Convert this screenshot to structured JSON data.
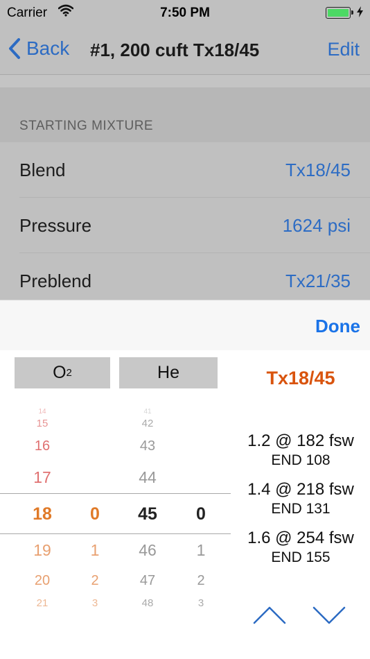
{
  "status": {
    "carrier": "Carrier",
    "time": "7:50 PM",
    "battery_color": "#4cd964"
  },
  "nav": {
    "back_label": "Back",
    "title": "#1, 200 cuft Tx18/45",
    "edit_label": "Edit"
  },
  "section": {
    "header": "STARTING MIXTURE"
  },
  "rows": [
    {
      "label": "Blend",
      "value": "Tx18/45"
    },
    {
      "label": "Pressure",
      "value": "1624 psi"
    },
    {
      "label": "Preblend",
      "value": "Tx21/35"
    }
  ],
  "picker": {
    "done_label": "Done",
    "o2_label": "O",
    "o2_sub": "2",
    "he_label": "He",
    "mix_name": "Tx18/45",
    "o2_tens": [
      "14",
      "15",
      "16",
      "17",
      "18",
      "19",
      "20",
      "21"
    ],
    "o2_units": [
      "0",
      "1",
      "2",
      "3"
    ],
    "he_tens": [
      "41",
      "42",
      "43",
      "44",
      "45",
      "46",
      "47",
      "48"
    ],
    "he_units": [
      "0",
      "1",
      "2",
      "3"
    ]
  },
  "mod": [
    {
      "line1": "1.2 @ 182 fsw",
      "line2": "END 108"
    },
    {
      "line1": "1.4 @ 218 fsw",
      "line2": "END 131"
    },
    {
      "line1": "1.6 @ 254 fsw",
      "line2": "END 155"
    }
  ],
  "colors": {
    "accent_blue": "#2c6bc3",
    "mix_orange": "#d9540e",
    "o2_red": "#e07070",
    "o2_orange": "#e8a070"
  }
}
